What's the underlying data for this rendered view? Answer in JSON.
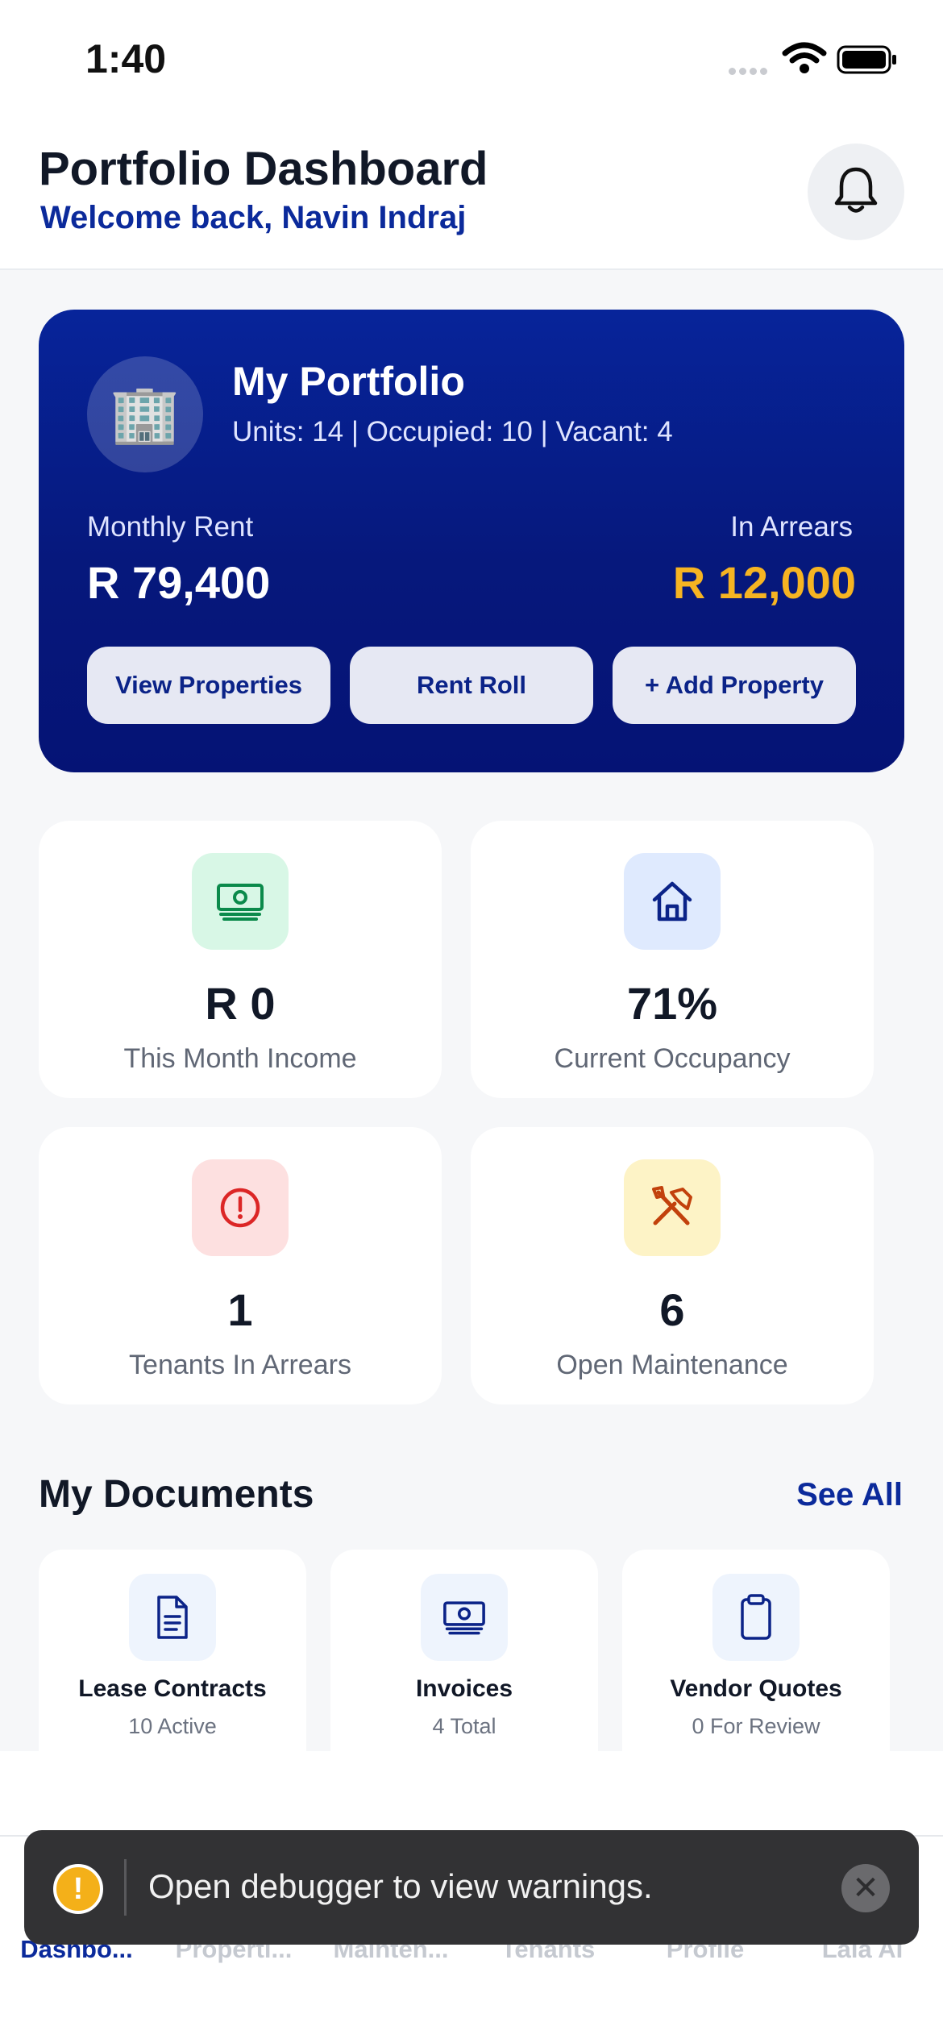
{
  "status_bar": {
    "time": "1:40"
  },
  "header": {
    "title": "Portfolio Dashboard",
    "subtitle": "Welcome back, Navin Indraj"
  },
  "portfolio": {
    "title": "My Portfolio",
    "meta": "Units: 14 | Occupied: 10 | Vacant: 4",
    "monthly_rent_label": "Monthly Rent",
    "monthly_rent": "R 79,400",
    "arrears_label": "In Arrears",
    "arrears": "R 12,000",
    "buttons": [
      "View Properties",
      "Rent Roll",
      "+ Add Property"
    ]
  },
  "stats": [
    {
      "value": "R 0",
      "label": "This Month Income",
      "icon": "cash-icon"
    },
    {
      "value": "71%",
      "label": "Current Occupancy",
      "icon": "house-icon"
    },
    {
      "value": "1",
      "label": "Tenants In Arrears",
      "icon": "alert-icon"
    },
    {
      "value": "6",
      "label": "Open Maintenance",
      "icon": "tools-icon"
    }
  ],
  "documents": {
    "title": "My Documents",
    "see_all": "See All",
    "items": [
      {
        "name": "Lease Contracts",
        "sub": "10 Active",
        "icon": "document-icon"
      },
      {
        "name": "Invoices",
        "sub": "4 Total",
        "icon": "cash-icon"
      },
      {
        "name": "Vendor Quotes",
        "sub": "0 For Review",
        "icon": "clipboard-icon"
      }
    ]
  },
  "toast": {
    "text": "Open debugger to view warnings."
  },
  "tabs": [
    "Dashbo...",
    "Properti...",
    "Mainten...",
    "Tenants",
    "Profile",
    "Lala AI"
  ],
  "colors": {
    "brand": "#0b2a9b",
    "card_gradient_top": "#07249a",
    "arrears": "#f6b422"
  }
}
